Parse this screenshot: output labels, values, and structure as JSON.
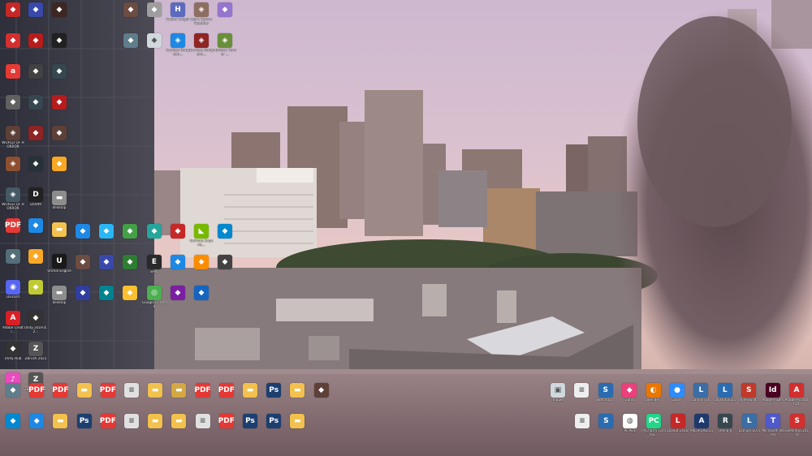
{
  "desktop": {
    "columns": [
      [
        {
          "name": "",
          "icon": "app-red",
          "color": "#c62828"
        },
        {
          "name": "",
          "icon": "app-red",
          "color": "#d32f2f"
        },
        {
          "name": "",
          "icon": "avira-icon",
          "color": "#e53935"
        },
        {
          "name": "",
          "icon": "app-gray",
          "color": "#616161"
        },
        {
          "name": "WORLD OF HORROR",
          "icon": "game-icon",
          "color": "#5d4037"
        },
        {
          "name": "",
          "icon": "game-icon",
          "color": "#8d4f2f"
        },
        {
          "name": "WORLD OF HORROR",
          "icon": "game-icon",
          "color": "#455a64"
        },
        {
          "name": "",
          "icon": "pdf-icon",
          "color": "#e53935"
        },
        {
          "name": "",
          "icon": "app-gray",
          "color": "#546e7a"
        },
        {
          "name": "Discord",
          "icon": "discord-icon",
          "color": "#5865f2"
        },
        {
          "name": "Adobe Creati...",
          "icon": "adobe-icon",
          "color": "#da1f26"
        },
        {
          "name": "Unity Hub",
          "icon": "unity-icon",
          "color": "#333333"
        },
        {
          "name": "iTunes",
          "icon": "itunes-icon",
          "color": "#ea4cc0"
        }
      ],
      [
        {
          "name": "",
          "icon": "app-gray",
          "color": "#3949ab"
        },
        {
          "name": "",
          "icon": "app-red",
          "color": "#b71c1c"
        },
        {
          "name": "",
          "icon": "app-gray",
          "color": "#424242"
        },
        {
          "name": "",
          "icon": "app-gray",
          "color": "#37474f"
        },
        {
          "name": "",
          "icon": "app-red",
          "color": "#8e2424"
        },
        {
          "name": "",
          "icon": "app-gray",
          "color": "#263238"
        },
        {
          "name": "DOOM",
          "icon": "doom-icon",
          "color": "#222222"
        },
        {
          "name": "",
          "icon": "app-blue",
          "color": "#1e88e5"
        },
        {
          "name": "",
          "icon": "app-yellow",
          "color": "#f9a825"
        },
        {
          "name": "",
          "icon": "app-yellow",
          "color": "#c0ca33"
        },
        {
          "name": "Unity 2019.4.2...",
          "icon": "unity-icon",
          "color": "#333333"
        },
        {
          "name": "ZBrush 2021",
          "icon": "zbrush-icon",
          "color": "#555555"
        },
        {
          "name": "ZBrush 2021.6.2",
          "icon": "zbrush-icon",
          "color": "#555555"
        }
      ],
      [
        {
          "name": "",
          "icon": "app-gray",
          "color": "#3e2723"
        },
        {
          "name": "",
          "icon": "app-gray",
          "color": "#212121"
        },
        {
          "name": "",
          "icon": "app-gray",
          "color": "#37474f"
        },
        {
          "name": "",
          "icon": "app-red",
          "color": "#b71c1c"
        },
        {
          "name": "",
          "icon": "app-yellow",
          "color": "#5d4037"
        },
        {
          "name": "",
          "icon": "app-yellow",
          "color": "#f9a825"
        },
        {
          "name": "desktop",
          "icon": "folder-icon",
          "color": "#8d8d8d"
        },
        {
          "name": "",
          "icon": "folder-icon",
          "color": "#f2c14e"
        },
        {
          "name": "Unreal Engine",
          "icon": "unreal-icon",
          "color": "#1a1a1a"
        },
        {
          "name": "desktop",
          "icon": "folder-icon",
          "color": "#8d8d8d"
        }
      ]
    ],
    "upper_icons": [
      {
        "name": "",
        "icon": "app-gray",
        "color": "#6d4c41"
      },
      {
        "name": "",
        "icon": "app-gray",
        "color": "#9e9e9e"
      },
      {
        "name": "Hollow Knight",
        "icon": "hollow-knight-icon",
        "color": "#5c6bc0"
      },
      {
        "name": "Don't Starve Together",
        "icon": "game-icon",
        "color": "#8d6e63"
      },
      {
        "name": "",
        "icon": "app-gray",
        "color": "#9575cd"
      },
      {
        "name": "",
        "icon": "app-gray",
        "color": "#607d8b"
      },
      {
        "name": "",
        "icon": "app-gray",
        "color": "#cfd8dc"
      },
      {
        "name": "Darkest Dungeon...",
        "icon": "game-icon",
        "color": "#1e88e5"
      },
      {
        "name": "Darkest Dungeon...",
        "icon": "game-icon",
        "color": "#8e2424"
      },
      {
        "name": "Monster Hunter ...",
        "icon": "game-icon",
        "color": "#6a8f3a"
      }
    ],
    "mid_icons": [
      {
        "name": "",
        "icon": "app-blue",
        "color": "#1e88e5"
      },
      {
        "name": "",
        "icon": "app-blue",
        "color": "#29b6f6"
      },
      {
        "name": "",
        "icon": "app-green",
        "color": "#43a047"
      },
      {
        "name": "",
        "icon": "app-blue",
        "color": "#26a69a"
      },
      {
        "name": "",
        "icon": "app-red",
        "color": "#c62828"
      },
      {
        "name": "GeForce Experie...",
        "icon": "nvidia-icon",
        "color": "#76b900"
      },
      {
        "name": "",
        "icon": "app-blue",
        "color": "#0288d1"
      },
      {
        "name": "",
        "icon": "app-gray",
        "color": "#6d4c41"
      },
      {
        "name": "",
        "icon": "app-blue",
        "color": "#3949ab"
      },
      {
        "name": "",
        "icon": "app-green",
        "color": "#2e7d32"
      },
      {
        "name": "EPIC",
        "icon": "epic-icon",
        "color": "#2a2a2a"
      },
      {
        "name": "",
        "icon": "app-blue",
        "color": "#1e88e5"
      },
      {
        "name": "",
        "icon": "app-orange",
        "color": "#fb8c00"
      },
      {
        "name": "",
        "icon": "app-gray",
        "color": "#424242"
      },
      {
        "name": "",
        "icon": "app-blue",
        "color": "#303f9f"
      },
      {
        "name": "",
        "icon": "app-blue",
        "color": "#00838f"
      },
      {
        "name": "",
        "icon": "app-yellow",
        "color": "#fbc02d"
      },
      {
        "name": "Google Chrome",
        "icon": "chrome-icon",
        "color": "#4caf50"
      },
      {
        "name": "",
        "icon": "app-purple",
        "color": "#7b1fa2"
      },
      {
        "name": "",
        "icon": "app-blue",
        "color": "#1565c0"
      }
    ],
    "bottom_row_1": [
      {
        "name": "",
        "icon": "app-gray",
        "color": "#607d8b"
      },
      {
        "name": "",
        "icon": "pdf-icon",
        "color": "#e53935"
      },
      {
        "name": "",
        "icon": "pdf-icon",
        "color": "#e53935"
      },
      {
        "name": "",
        "icon": "folder-icon",
        "color": "#f2c14e"
      },
      {
        "name": "",
        "icon": "pdf-icon",
        "color": "#e53935"
      },
      {
        "name": "",
        "icon": "file-icon",
        "color": "#e0e0e0"
      },
      {
        "name": "",
        "icon": "folder-icon",
        "color": "#f2c14e"
      },
      {
        "name": "",
        "icon": "folder-icon",
        "color": "#d4a843"
      },
      {
        "name": "",
        "icon": "pdf-icon",
        "color": "#e53935"
      },
      {
        "name": "",
        "icon": "pdf-icon",
        "color": "#e53935"
      },
      {
        "name": "",
        "icon": "folder-icon",
        "color": "#f2c14e"
      },
      {
        "name": "",
        "icon": "photoshop-icon",
        "color": "#1c3f70"
      },
      {
        "name": "",
        "icon": "folder-icon",
        "color": "#f2c14e"
      },
      {
        "name": "",
        "icon": "app-gray",
        "color": "#5d4037"
      }
    ],
    "bottom_row_2": [
      {
        "name": "",
        "icon": "app-blue",
        "color": "#0288d1"
      },
      {
        "name": "",
        "icon": "app-blue",
        "color": "#1e88e5"
      },
      {
        "name": "",
        "icon": "folder-icon",
        "color": "#f2c14e"
      },
      {
        "name": "",
        "icon": "photoshop-icon",
        "color": "#1c3f70"
      },
      {
        "name": "",
        "icon": "pdf-icon",
        "color": "#e53935"
      },
      {
        "name": "",
        "icon": "file-icon",
        "color": "#e0e0e0"
      },
      {
        "name": "",
        "icon": "folder-icon",
        "color": "#f2c14e"
      },
      {
        "name": "",
        "icon": "folder-icon",
        "color": "#f2c14e"
      },
      {
        "name": "",
        "icon": "file-icon",
        "color": "#e0e0e0"
      },
      {
        "name": "",
        "icon": "pdf-icon",
        "color": "#e53935"
      },
      {
        "name": "",
        "icon": "photoshop-icon",
        "color": "#1c3f70"
      },
      {
        "name": "",
        "icon": "photoshop-icon",
        "color": "#1c3f70"
      },
      {
        "name": "",
        "icon": "folder-icon",
        "color": "#f2c14e"
      }
    ],
    "right_row_1": [
      {
        "name": "Images",
        "icon": "image-icon",
        "color": "#cfd8dc"
      },
      {
        "name": "",
        "icon": "file-icon",
        "color": "#eeeeee"
      },
      {
        "name": "SketchUp ...",
        "icon": "sketchup-icon",
        "color": "#2b6cb0"
      },
      {
        "name": "Zoho",
        "icon": "app-pink",
        "color": "#ec407a"
      },
      {
        "name": "Blender",
        "icon": "blender-icon",
        "color": "#ea7600"
      },
      {
        "name": "Zoom",
        "icon": "zoom-icon",
        "color": "#2d8cff"
      },
      {
        "name": "Lumion 10",
        "icon": "lumion-icon",
        "color": "#3a6ea5"
      },
      {
        "name": "LayOut 2021",
        "icon": "layout-icon",
        "color": "#2b6cb0"
      },
      {
        "name": "Style Build...",
        "icon": "style-builder-icon",
        "color": "#c0392b"
      },
      {
        "name": "Adobe InDesi...",
        "icon": "indesign-icon",
        "color": "#49021f"
      },
      {
        "name": "Adobe Acrobat DC",
        "icon": "acrobat-icon",
        "color": "#d32f2f"
      }
    ],
    "right_row_2": [
      {
        "name": "",
        "icon": "file-icon",
        "color": "#eeeeee"
      },
      {
        "name": "",
        "icon": "sketchup-icon",
        "color": "#2b6cb0"
      },
      {
        "name": "PicPick",
        "icon": "picpick-icon",
        "color": "#ffffff"
      },
      {
        "name": "PyCharm Commu...",
        "icon": "pycharm-icon",
        "color": "#21d789"
      },
      {
        "name": "Layout 2018",
        "icon": "layout-icon",
        "color": "#c62828"
      },
      {
        "name": "ARCHICAD 21",
        "icon": "archicad-icon",
        "color": "#1e3a6d"
      },
      {
        "name": "Rhino 6",
        "icon": "rhino-icon",
        "color": "#37474f"
      },
      {
        "name": "Lumion 10.3",
        "icon": "lumion-icon",
        "color": "#3a6ea5"
      },
      {
        "name": "Microsoft Teams",
        "icon": "teams-icon",
        "color": "#5059c9"
      },
      {
        "name": "SketchUp 2018",
        "icon": "sketchup-icon",
        "color": "#d32f2f"
      }
    ]
  }
}
